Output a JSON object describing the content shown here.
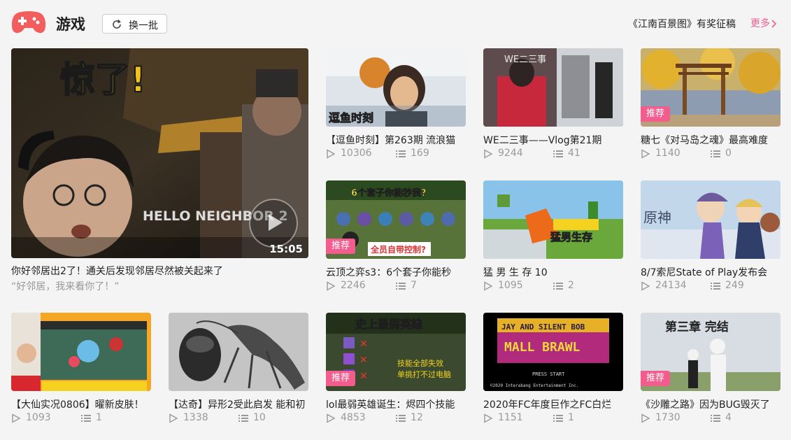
{
  "header": {
    "section_title": "游戏",
    "refresh_label": "换一批",
    "promo_text": "《江南百景图》有奖征稿",
    "more_label": "更多",
    "accent_color": "#f25d8e"
  },
  "featured": {
    "title": "你好邻居出2了！通关后发现邻居尽然被关起来了",
    "subtitle": "“好邻居，我来看你了！”",
    "duration": "15:05",
    "overlay_text": "惊了!",
    "logo_text": "HELLO NEIGHBOR 2"
  },
  "videos": [
    {
      "title": "【逗鱼时刻】第263期  流浪猫",
      "plays": "10306",
      "danmaku": "169",
      "badge": "",
      "overlay": "逗鱼时刻"
    },
    {
      "title": "WE二三事——Vlog第21期",
      "plays": "9244",
      "danmaku": "41",
      "badge": "",
      "overlay": "WE二三事"
    },
    {
      "title": "糖七《对马岛之魂》最高难度",
      "plays": "1140",
      "danmaku": "0",
      "badge": "推荐",
      "overlay": ""
    },
    {
      "title": "云顶之弈s3：6个套子你能秒",
      "plays": "2246",
      "danmaku": "7",
      "badge": "推荐",
      "overlay": "6个套子你能秒我?"
    },
    {
      "title": "猛 男 生 存 10",
      "plays": "1095",
      "danmaku": "2",
      "badge": "",
      "overlay": "猛男生存"
    },
    {
      "title": "8/7索尼State of Play发布会",
      "plays": "24134",
      "danmaku": "249",
      "badge": "",
      "overlay": "原神"
    },
    {
      "title": "【大仙实况0806】曜新皮肤！",
      "plays": "1093",
      "danmaku": "1",
      "badge": "",
      "overlay": ""
    },
    {
      "title": "【达奇】异形2受此启发 能和初",
      "plays": "1338",
      "danmaku": "10",
      "badge": "",
      "overlay": ""
    },
    {
      "title": "lol最弱英雄诞生：烬四个技能",
      "plays": "4853",
      "danmaku": "12",
      "badge": "推荐",
      "overlay": "史上最弱英雄"
    },
    {
      "title": "2020年FC年度巨作之FC白烂",
      "plays": "1151",
      "danmaku": "1",
      "badge": "",
      "overlay": "JAY AND SILENT BOB MALL BRAWL"
    },
    {
      "title": "《沙雕之路》因为BUG毁灭了",
      "plays": "1730",
      "danmaku": "4",
      "badge": "推荐",
      "overlay": "第三章 完结"
    }
  ]
}
